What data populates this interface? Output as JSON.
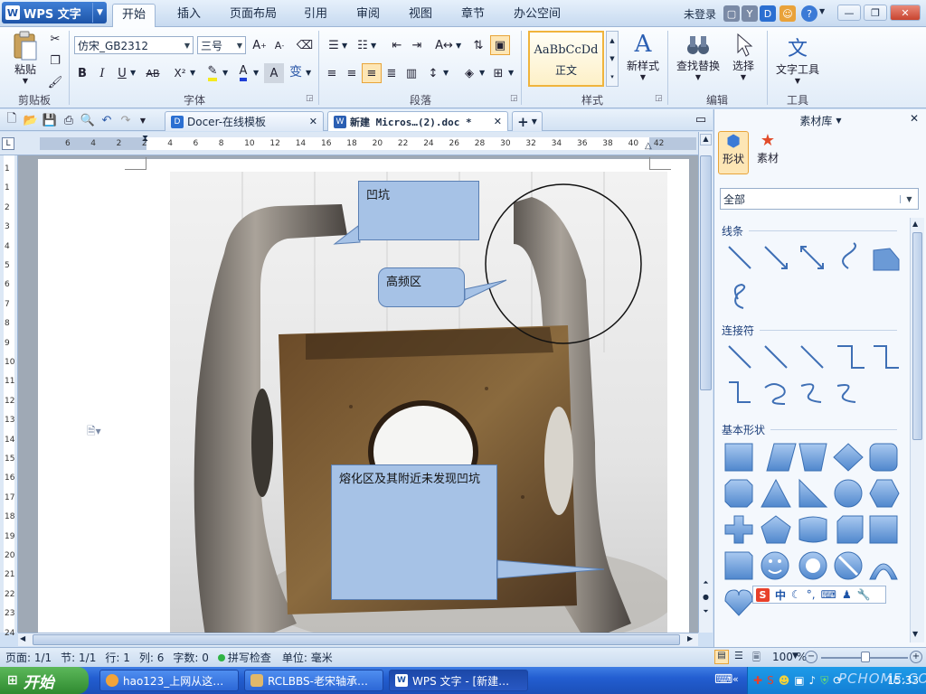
{
  "app": {
    "logo_label": "WPS 文字",
    "logo_letter": "W",
    "login": "未登录"
  },
  "menu": {
    "tabs": [
      "开始",
      "插入",
      "页面布局",
      "引用",
      "审阅",
      "视图",
      "章节",
      "办公空间"
    ]
  },
  "ribbon": {
    "clipboard": {
      "paste": "粘贴",
      "title": "剪贴板"
    },
    "font": {
      "family": "仿宋_GB2312",
      "size": "三号",
      "title": "字体",
      "bold": "B",
      "italic": "I",
      "underline": "U",
      "strike": "AB",
      "superscript": "X²",
      "font_color": "A",
      "char_shade": "A",
      "phonetic": "变"
    },
    "paragraph": {
      "title": "段落"
    },
    "styles": {
      "sample": "AaBbCcDd",
      "name": "正文",
      "new_style": "新样式",
      "title": "样式"
    },
    "editing": {
      "find": "查找替换",
      "select": "选择",
      "title": "编辑"
    },
    "tools": {
      "text_tools": "文字工具",
      "title": "工具"
    }
  },
  "doctabs": {
    "tab1": "Docer-在线模板",
    "tab2": "新建 Micros…(2).doc *",
    "add": "+"
  },
  "ruler": {
    "h_ticks": [
      "6",
      "4",
      "2",
      "2",
      "4",
      "6",
      "8",
      "10",
      "12",
      "14",
      "16",
      "18",
      "20",
      "22",
      "24",
      "26",
      "28",
      "30",
      "32",
      "34",
      "36",
      "38",
      "40",
      "42"
    ],
    "v_ticks": [
      "1",
      "1",
      "2",
      "3",
      "4",
      "5",
      "6",
      "7",
      "8",
      "9",
      "10",
      "11",
      "12",
      "13",
      "14",
      "15",
      "16",
      "17",
      "18",
      "19",
      "20",
      "21",
      "22",
      "23",
      "24"
    ]
  },
  "document": {
    "callouts": {
      "pit": "凹坑",
      "hf": "高频区",
      "melt": "熔化区及其附近未发现凹坑"
    }
  },
  "pane": {
    "title": "素材库",
    "tab_shapes": "形状",
    "tab_materials": "素材",
    "filter": "全部",
    "sections": {
      "lines": "线条",
      "connectors": "连接符",
      "basic": "基本形状"
    }
  },
  "status": {
    "page": "页面: 1/1",
    "section": "节: 1/1",
    "row": "行: 1",
    "col": "列: 6",
    "words": "字数: 0",
    "spell": "拼写检查",
    "unit": "单位: 毫米",
    "zoom": "100 %"
  },
  "taskbar": {
    "start": "开始",
    "tasks": [
      "hao123_上网从这…",
      "RCLBBS-老宋轴承…",
      "WPS 文字 - [新建…"
    ],
    "time": "15:33",
    "watermark": "PCHOME.COM"
  },
  "ime": {
    "s": "S",
    "zh": "中"
  },
  "colors": {
    "accent": "#1d54a8",
    "callout": "#a6c2e6",
    "taskbar": "#235ed1",
    "start": "#2f8a30"
  }
}
